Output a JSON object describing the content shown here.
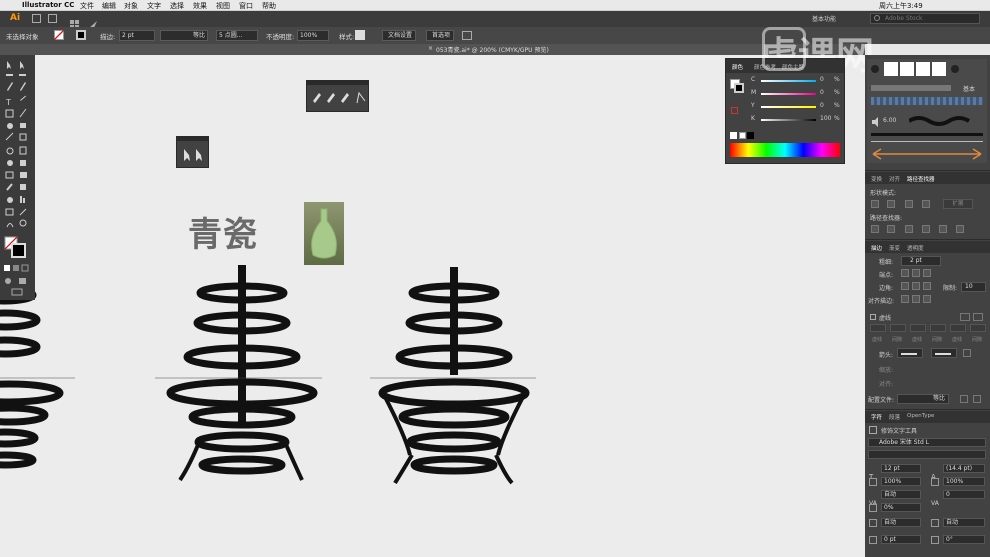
{
  "menubar": {
    "apple": "",
    "app_name": "Illustrator CC",
    "menus": [
      "文件",
      "编辑",
      "对象",
      "文字",
      "选择",
      "效果",
      "视图",
      "窗口",
      "帮助"
    ],
    "clock": "周六上午3:49"
  },
  "appbar": {
    "logo": "Ai",
    "workspace": "基本功能",
    "search_placeholder": "Adobe Stock"
  },
  "control": {
    "no_selection": "未选择对象",
    "stroke_label": "描边:",
    "stroke_value": "2 pt",
    "stroke_style": "等比",
    "brush_value": "5 点圆...",
    "opacity_label": "不透明度:",
    "opacity_value": "100%",
    "style_label": "样式:",
    "doc_setup": "文档设置",
    "preferences": "首选项"
  },
  "document": {
    "tab_title": "053青瓷.ai* @ 200% (CMYK/GPU 预览)"
  },
  "canvas": {
    "heading": "青瓷",
    "brand_watermark": "虎课网"
  },
  "color_panel": {
    "tabs": [
      "颜色",
      "颜色参考",
      "颜色主题"
    ],
    "channels": [
      {
        "label": "C",
        "value": "0"
      },
      {
        "label": "M",
        "value": "0"
      },
      {
        "label": "Y",
        "value": "0"
      },
      {
        "label": "K",
        "value": "100"
      }
    ],
    "unit": "%"
  },
  "brush_panel": {
    "basic_label": "基本",
    "size_value": "6.00"
  },
  "pathfinder_panel": {
    "tabs": [
      "变换",
      "对齐",
      "路径查找器"
    ],
    "shape_modes": "形状模式:",
    "expand": "扩展",
    "pathfinders": "路径查找器:"
  },
  "stroke_panel": {
    "tabs": [
      "描边",
      "渐变",
      "透明度"
    ],
    "weight_label": "粗细:",
    "weight_value": "2 pt",
    "cap_label": "端点:",
    "corner_label": "边角:",
    "limit_label": "限制:",
    "limit_value": "10",
    "align_label": "对齐描边:",
    "dashed_label": "虚线",
    "dash_cells": [
      "虚线",
      "间隙",
      "虚线",
      "间隙",
      "虚线",
      "间隙"
    ],
    "arrow_label": "箭头:",
    "scale_label": "缩放:",
    "align_arrow_label": "对齐:",
    "profile_label": "配置文件:",
    "profile_value": "等比"
  },
  "character_panel": {
    "tabs": [
      "字符",
      "段落",
      "OpenType"
    ],
    "touch_type": "修饰文字工具",
    "font_name": "Adobe 宋体 Std L",
    "font_style": "",
    "size_value": "12 pt",
    "leading_value": "(14.4 pt)",
    "hscale_value": "100%",
    "vscale_value": "100%",
    "kerning_value": "自动",
    "tracking_value": "0",
    "tsume_value": "0%",
    "aki_left": "自动",
    "aki_right": "自动",
    "baseline_value": "0 pt",
    "rotation_value": "0°"
  }
}
